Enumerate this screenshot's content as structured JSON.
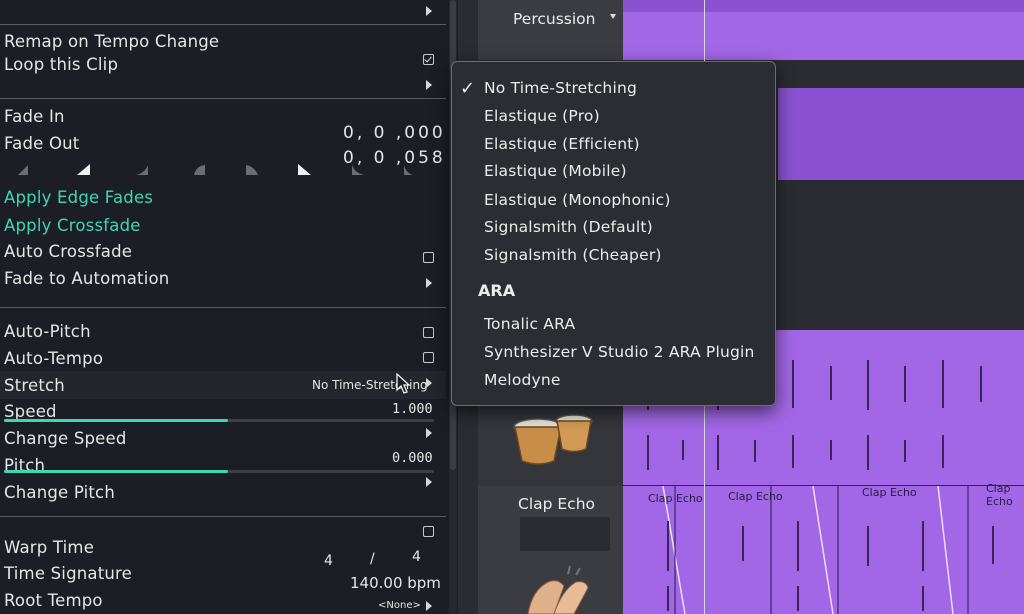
{
  "inspector": {
    "remap_on_tempo_change": "Remap on Tempo Change",
    "loop_this_clip": "Loop this Clip",
    "fade_in": "Fade In",
    "fade_out": "Fade Out",
    "fade_in_value": "0, 0 ,000",
    "fade_out_value": "0, 0 ,058",
    "apply_edge_fades": "Apply Edge Fades",
    "apply_crossfade": "Apply Crossfade",
    "auto_crossfade": "Auto Crossfade",
    "fade_to_automation": "Fade to Automation",
    "auto_pitch": "Auto-Pitch",
    "auto_tempo": "Auto-Tempo",
    "stretch": "Stretch",
    "stretch_value": "No Time-Stretching",
    "speed": "Speed",
    "speed_value": "1.000",
    "speed_level": 0.52,
    "change_speed": "Change Speed",
    "pitch": "Pitch",
    "pitch_value": "0.000",
    "pitch_level": 0.52,
    "change_pitch": "Change Pitch",
    "warp_time": "Warp Time",
    "time_signature": "Time Signature",
    "time_sig_num": "4",
    "time_sig_sep": "/",
    "time_sig_den": "4",
    "bpm_value": "140.00 bpm",
    "root_tempo": "Root Tempo",
    "root_tempo_value": "<None>",
    "loop_checked": true
  },
  "tracks": {
    "percussion": "Percussion",
    "clap_echo": "Clap Echo",
    "clip_labels": [
      "Clap Echo",
      "Clap Echo",
      "Clap Echo",
      "Clap Echo"
    ]
  },
  "menu": {
    "items": [
      "No Time-Stretching",
      "Elastique (Pro)",
      "Elastique (Efficient)",
      "Elastique (Mobile)",
      "Elastique (Monophonic)",
      "Signalsmith (Default)",
      "Signalsmith (Cheaper)"
    ],
    "section_header": "ARA",
    "ara_items": [
      "Tonalic ARA",
      "Synthesizer V Studio 2 ARA Plugin",
      "Melodyne"
    ],
    "checkmark": "✓"
  },
  "colors": {
    "accent": "#3ed7b5",
    "clip_purple": "#a267e6",
    "panel_bg": "#1b1e24"
  }
}
